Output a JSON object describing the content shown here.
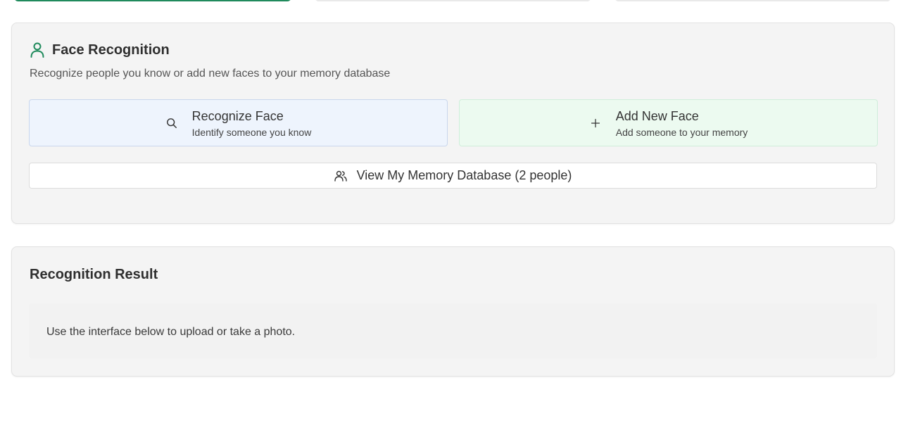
{
  "colors": {
    "accent": "#1f8a5c",
    "recognize_bg": "#eef4fd",
    "add_bg": "#ecfaf0"
  },
  "face_recognition": {
    "icon": "user-icon",
    "title": "Face Recognition",
    "subtitle": "Recognize people you know or add new faces to your memory database",
    "recognize": {
      "icon": "search-icon",
      "label": "Recognize Face",
      "description": "Identify someone you know"
    },
    "add": {
      "icon": "plus-icon",
      "label": "Add New Face",
      "description": "Add someone to your memory"
    },
    "database": {
      "icon": "users-icon",
      "label": "View My Memory Database (2 people)"
    }
  },
  "recognition_result": {
    "title": "Recognition Result",
    "message": "Use the interface below to upload or take a photo."
  }
}
